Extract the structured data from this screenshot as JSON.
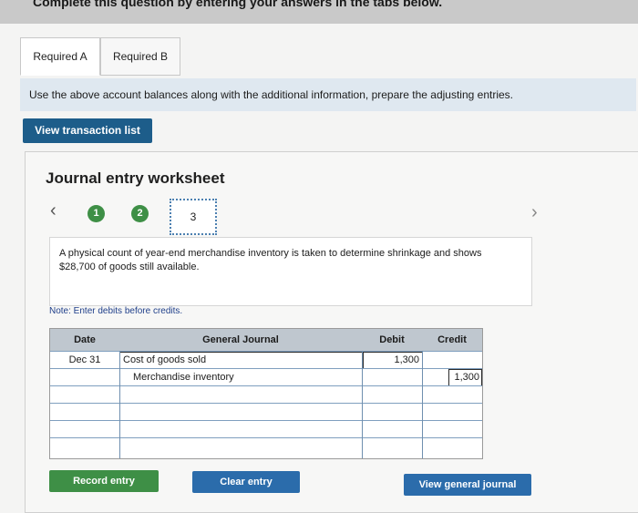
{
  "banner": {
    "text": "Complete this question by entering your answers in the tabs below."
  },
  "tabs": [
    {
      "label": "Required A"
    },
    {
      "label": "Required B"
    }
  ],
  "instruction": "Use the above account balances along with the additional information, prepare the adjusting entries.",
  "buttons": {
    "view_transactions": "View transaction list",
    "record_entry": "Record entry",
    "clear_entry": "Clear entry",
    "view_general_journal": "View general journal"
  },
  "worksheet": {
    "title": "Journal entry worksheet",
    "steps": [
      "1",
      "2",
      "3"
    ],
    "description": "A physical count of year-end merchandise inventory is taken to determine shrinkage and shows $28,700 of goods still available.",
    "note": "Note: Enter debits before credits."
  },
  "journal": {
    "headers": {
      "date": "Date",
      "account": "General Journal",
      "debit": "Debit",
      "credit": "Credit"
    },
    "rows": [
      {
        "date": "Dec 31",
        "account": "Cost of goods sold",
        "debit": "1,300",
        "credit": ""
      },
      {
        "date": "",
        "account": "Merchandise inventory",
        "debit": "",
        "credit": "1,300"
      },
      {
        "date": "",
        "account": "",
        "debit": "",
        "credit": ""
      },
      {
        "date": "",
        "account": "",
        "debit": "",
        "credit": ""
      },
      {
        "date": "",
        "account": "",
        "debit": "",
        "credit": ""
      },
      {
        "date": "",
        "account": "",
        "debit": "",
        "credit": ""
      }
    ]
  },
  "colors": {
    "primary_button": "#1d5d8a",
    "green_button": "#3e8f46",
    "blue_button": "#2b6cab",
    "header_gray": "#bfc7cf"
  }
}
